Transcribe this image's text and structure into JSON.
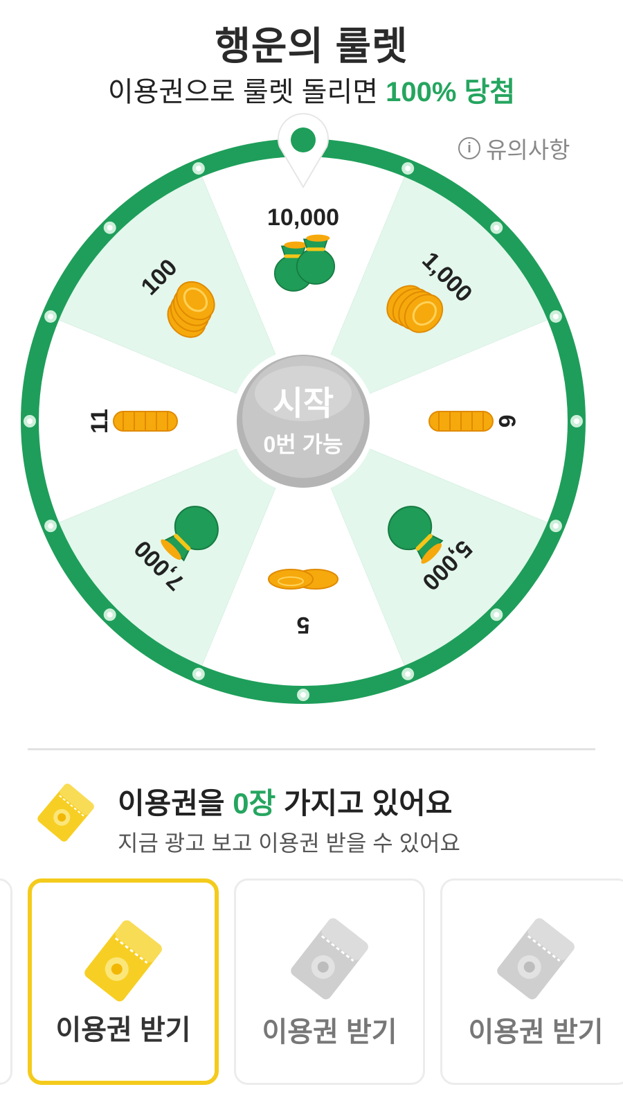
{
  "header": {
    "title": "행운의 룰렛",
    "subtitle_prefix": "이용권으로 룰렛 돌리면 ",
    "subtitle_highlight": "100% 당첨"
  },
  "notice": {
    "icon": "info-icon",
    "label": "유의사항"
  },
  "wheel": {
    "segments": [
      {
        "label": "10,000",
        "icon": "money-bags"
      },
      {
        "label": "1,000",
        "icon": "coin-stack"
      },
      {
        "label": "6",
        "icon": "coin-roll"
      },
      {
        "label": "5,000",
        "icon": "money-bag"
      },
      {
        "label": "5",
        "icon": "coins-flat"
      },
      {
        "label": "7,000",
        "icon": "money-bag"
      },
      {
        "label": "11",
        "icon": "coin-roll"
      },
      {
        "label": "100",
        "icon": "coin-stack"
      }
    ],
    "start_label": "시작",
    "remaining_label": "0번 가능",
    "colors": {
      "ring": "#1e9e5a",
      "segment_light": "#e3f7ec",
      "segment_white": "#ffffff",
      "coin": "#f6a90c",
      "bag": "#1f9c57"
    }
  },
  "ticket": {
    "count_prefix": "이용권을 ",
    "count_value": "0장",
    "count_suffix": " 가지고 있어요",
    "hint": "지금 광고 보고 이용권 받을 수 있어요"
  },
  "cards": [
    {
      "label": "이용권 받기",
      "state": "active"
    },
    {
      "label": "이용권 받기",
      "state": "disabled"
    },
    {
      "label": "이용권 받기",
      "state": "disabled"
    }
  ],
  "colors": {
    "accent": "#25a55f",
    "ticket_yellow": "#f7cf24",
    "active_border": "#f4cb1c"
  }
}
